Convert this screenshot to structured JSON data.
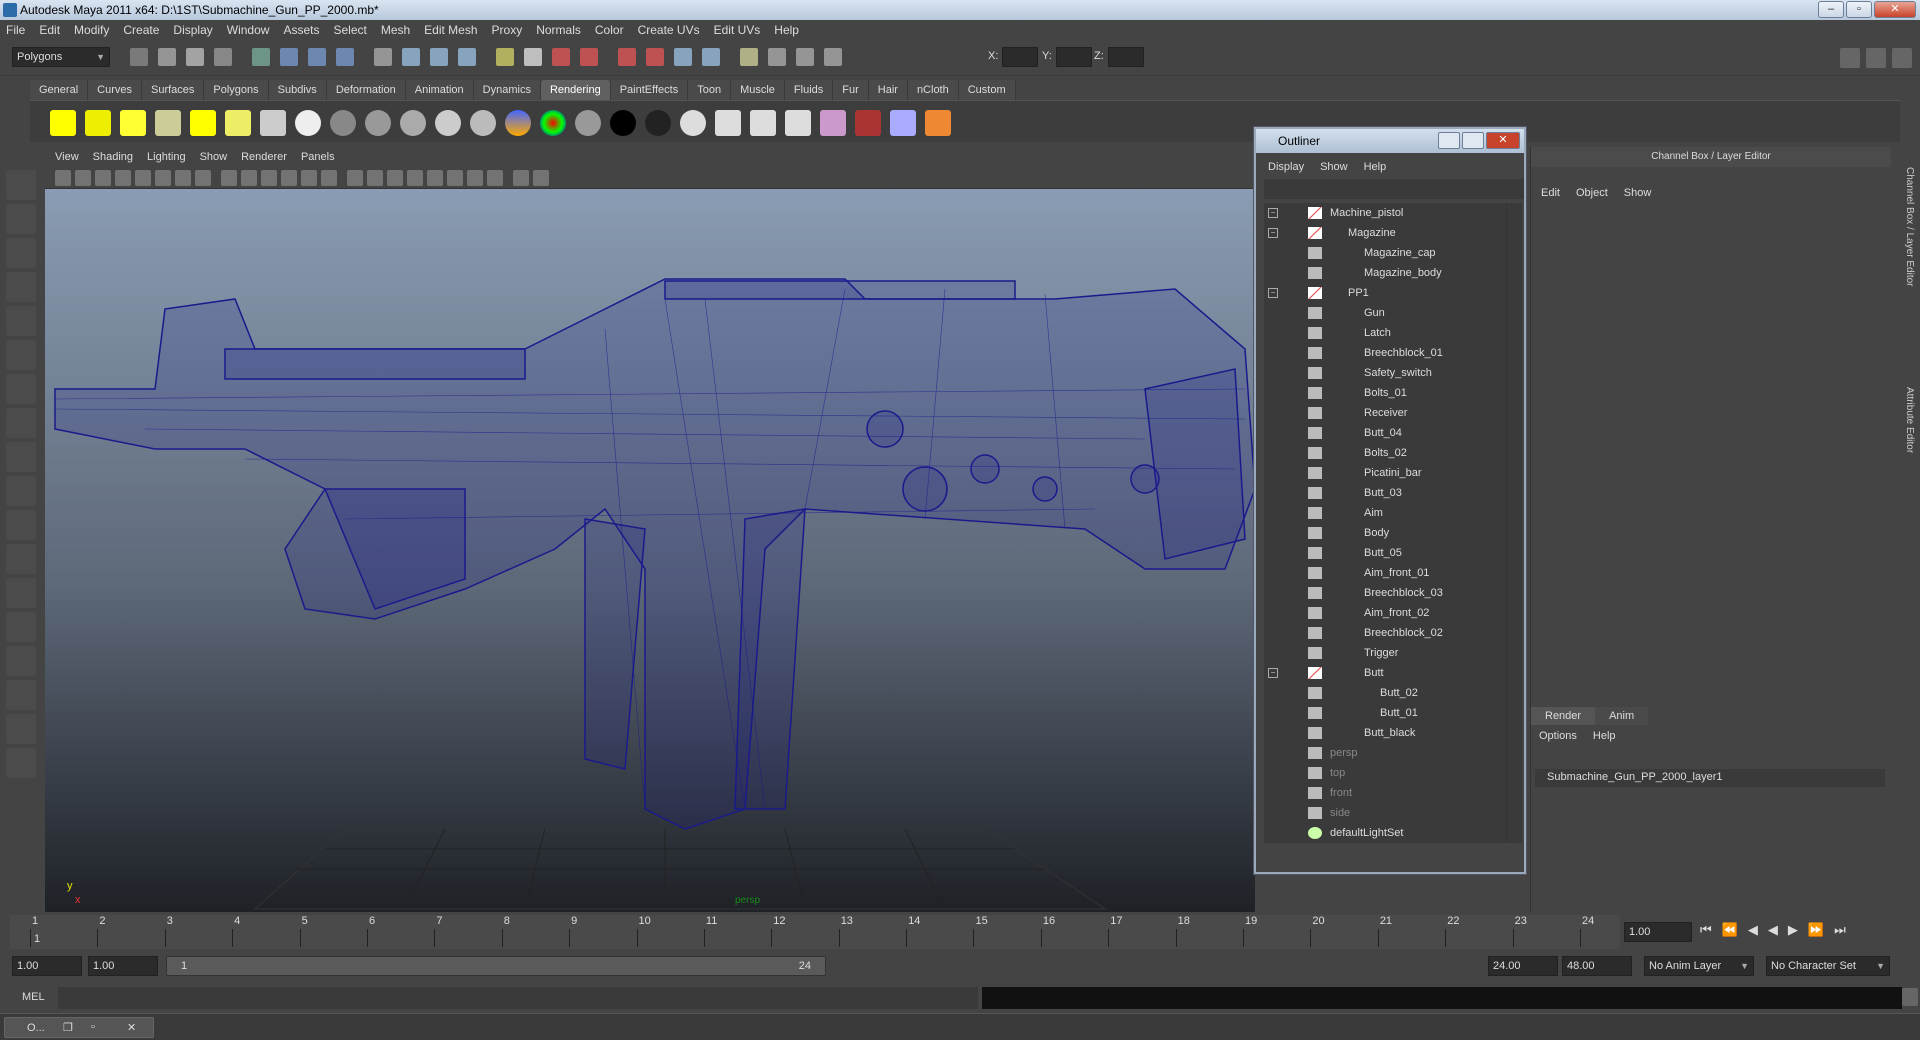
{
  "window": {
    "title": "Autodesk Maya 2011 x64: D:\\1ST\\Submachine_Gun_PP_2000.mb*"
  },
  "menu": [
    "File",
    "Edit",
    "Modify",
    "Create",
    "Display",
    "Window",
    "Assets",
    "Select",
    "Mesh",
    "Edit Mesh",
    "Proxy",
    "Normals",
    "Color",
    "Create UVs",
    "Edit UVs",
    "Help"
  ],
  "status_line": {
    "mode": "Polygons",
    "x_label": "X:",
    "y_label": "Y:",
    "z_label": "Z:"
  },
  "shelf_tabs": [
    "General",
    "Curves",
    "Surfaces",
    "Polygons",
    "Subdivs",
    "Deformation",
    "Animation",
    "Dynamics",
    "Rendering",
    "PaintEffects",
    "Toon",
    "Muscle",
    "Fluids",
    "Fur",
    "Hair",
    "nCloth",
    "Custom"
  ],
  "active_shelf_tab": "Rendering",
  "viewport": {
    "menu": [
      "View",
      "Shading",
      "Lighting",
      "Show",
      "Renderer",
      "Panels"
    ],
    "camera_label": "persp",
    "axis_y": "y",
    "axis_x": "x"
  },
  "outliner": {
    "title": "Outliner",
    "menu": [
      "Display",
      "Show",
      "Help"
    ],
    "items": [
      {
        "name": "Machine_pistol",
        "depth": 0,
        "expand": "⊟",
        "type": "group"
      },
      {
        "name": "Magazine",
        "depth": 1,
        "expand": "⊟",
        "type": "group"
      },
      {
        "name": "Magazine_cap",
        "depth": 2,
        "type": "mesh"
      },
      {
        "name": "Magazine_body",
        "depth": 2,
        "type": "mesh"
      },
      {
        "name": "PP1",
        "depth": 1,
        "expand": "⊟",
        "type": "group"
      },
      {
        "name": "Gun",
        "depth": 2,
        "type": "mesh"
      },
      {
        "name": "Latch",
        "depth": 2,
        "type": "mesh"
      },
      {
        "name": "Breechblock_01",
        "depth": 2,
        "type": "mesh"
      },
      {
        "name": "Safety_switch",
        "depth": 2,
        "type": "mesh"
      },
      {
        "name": "Bolts_01",
        "depth": 2,
        "type": "mesh"
      },
      {
        "name": "Receiver",
        "depth": 2,
        "type": "mesh"
      },
      {
        "name": "Butt_04",
        "depth": 2,
        "type": "mesh"
      },
      {
        "name": "Bolts_02",
        "depth": 2,
        "type": "mesh"
      },
      {
        "name": "Picatini_bar",
        "depth": 2,
        "type": "mesh"
      },
      {
        "name": "Butt_03",
        "depth": 2,
        "type": "mesh"
      },
      {
        "name": "Aim",
        "depth": 2,
        "type": "mesh"
      },
      {
        "name": "Body",
        "depth": 2,
        "type": "mesh"
      },
      {
        "name": "Butt_05",
        "depth": 2,
        "type": "mesh"
      },
      {
        "name": "Aim_front_01",
        "depth": 2,
        "type": "mesh"
      },
      {
        "name": "Breechblock_03",
        "depth": 2,
        "type": "mesh"
      },
      {
        "name": "Aim_front_02",
        "depth": 2,
        "type": "mesh"
      },
      {
        "name": "Breechblock_02",
        "depth": 2,
        "type": "mesh"
      },
      {
        "name": "Trigger",
        "depth": 2,
        "type": "mesh"
      },
      {
        "name": "Butt",
        "depth": 2,
        "expand": "⊟",
        "type": "group"
      },
      {
        "name": "Butt_02",
        "depth": 3,
        "type": "mesh"
      },
      {
        "name": "Butt_01",
        "depth": 3,
        "type": "mesh"
      },
      {
        "name": "Butt_black",
        "depth": 2,
        "type": "mesh"
      },
      {
        "name": "persp",
        "depth": 0,
        "type": "camera"
      },
      {
        "name": "top",
        "depth": 0,
        "type": "camera"
      },
      {
        "name": "front",
        "depth": 0,
        "type": "camera"
      },
      {
        "name": "side",
        "depth": 0,
        "type": "camera"
      },
      {
        "name": "defaultLightSet",
        "depth": 0,
        "type": "set"
      }
    ]
  },
  "channel_box": {
    "title": "Channel Box / Layer Editor",
    "menu": [
      "Edit",
      "Object",
      "Show"
    ],
    "layer_tabs": [
      "Render",
      "Anim"
    ],
    "layer_menu": [
      "Options",
      "Help"
    ],
    "layer_name": "Submachine_Gun_PP_2000_layer1",
    "side_tabs": [
      "Channel Box / Layer Editor",
      "Attribute Editor"
    ]
  },
  "timeline": {
    "ticks": [
      "1",
      "2",
      "3",
      "4",
      "5",
      "6",
      "7",
      "8",
      "9",
      "10",
      "11",
      "12",
      "13",
      "14",
      "15",
      "16",
      "17",
      "18",
      "19",
      "20",
      "21",
      "22",
      "23",
      "24"
    ],
    "current_frame": "1.00",
    "current_marker": "1"
  },
  "range": {
    "start": "1.00",
    "playback_start": "1.00",
    "slider_start": "1",
    "slider_end": "24",
    "playback_end": "24.00",
    "end": "48.00",
    "anim_layer": "No Anim Layer",
    "character_set": "No Character Set"
  },
  "command_line": {
    "label": "MEL"
  },
  "taskbar": {
    "item": "O..."
  },
  "colors": {
    "wire": "#1a1a8c",
    "bg": "#444444",
    "accent": "#c8432b"
  }
}
